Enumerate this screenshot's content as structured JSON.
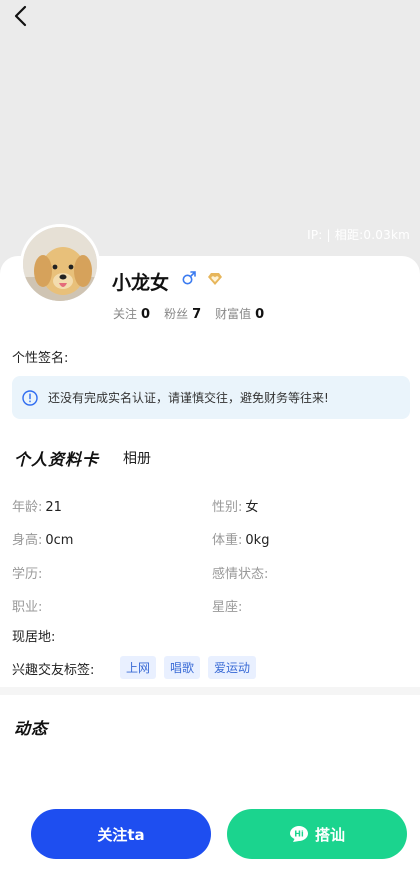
{
  "header": {
    "ip_text": "IP: | 相距:0.03km"
  },
  "profile": {
    "name": "小龙女",
    "gender_icon": "male-icon",
    "vip_icon": "vip-heart-icon",
    "stats": [
      {
        "label": "关注",
        "value": "0"
      },
      {
        "label": "粉丝",
        "value": "7"
      },
      {
        "label": "财富值",
        "value": "0"
      }
    ],
    "signature_label": "个性签名:"
  },
  "notice": {
    "text": "还没有完成实名认证，请谨慎交往，避免财务等往来!",
    "icon": "info-icon"
  },
  "tabs": {
    "active": "个人资料卡",
    "album": "相册"
  },
  "fields": {
    "age_label": "年龄:",
    "age_value": "21",
    "gender_label": "性别:",
    "gender_value": "女",
    "height_label": "身高:",
    "height_value": "0cm",
    "weight_label": "体重:",
    "weight_value": "0kg",
    "education_label": "学历:",
    "relationship_label": "感情状态:",
    "job_label": "职业:",
    "zodiac_label": "星座:",
    "residence_label": "现居地:",
    "interest_label": "兴趣交友标签:"
  },
  "tags": [
    "上网",
    "唱歌",
    "爱运动"
  ],
  "dynamic": {
    "title": "动态"
  },
  "actions": {
    "follow_label": "关注ta",
    "chat_label": "搭讪",
    "follow_color": "#1e4ef0",
    "chat_color": "#1bd48e"
  }
}
